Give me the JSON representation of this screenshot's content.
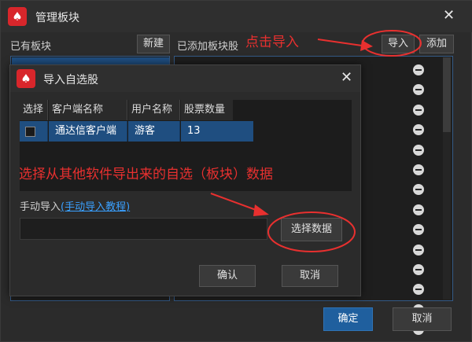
{
  "outer": {
    "title": "管理板块",
    "close_glyph": "✕",
    "existing_label": "已有板块",
    "new_button": "新建",
    "added_label": "已添加板块股",
    "import_button": "导入",
    "add_button": "添加",
    "confirm_button": "确定",
    "cancel_button": "取消"
  },
  "inner": {
    "title": "导入自选股",
    "close_glyph": "✕",
    "columns": [
      "选择",
      "客户端名称",
      "用户名称",
      "股票数量"
    ],
    "rows": [
      {
        "checked": false,
        "client": "通达信客户端",
        "user": "游客",
        "count": "13"
      }
    ],
    "manual_label": "手动导入",
    "manual_link": "(手动导入教程)",
    "select_data_button": "选择数据",
    "confirm_button": "确认",
    "cancel_button": "取消"
  },
  "annotations": {
    "click_import": "点击导入",
    "select_data_hint": "选择从其他软件导出来的自选（板块）数据"
  },
  "colors": {
    "annotation": "#e8302f",
    "selection": "#1f4e80",
    "primary_button": "#1f5f9e",
    "app_icon": "#d8262b"
  }
}
